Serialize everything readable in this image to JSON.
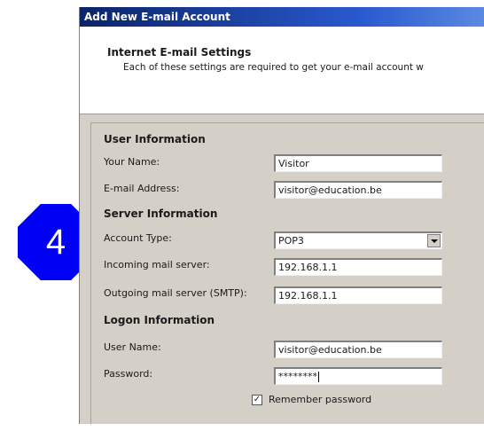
{
  "window": {
    "title": "Add New E-mail Account"
  },
  "header": {
    "title": "Internet E-mail Settings",
    "subtitle": "Each of these settings are required to get your e-mail account w"
  },
  "user_info": {
    "section_title": "User Information",
    "name_label": "Your Name:",
    "name_value": "Visitor",
    "email_label": "E-mail Address:",
    "email_value": "visitor@education.be"
  },
  "server_info": {
    "section_title": "Server Information",
    "account_type_label": "Account Type:",
    "account_type_value": "POP3",
    "incoming_label": "Incoming mail server:",
    "incoming_value": "192.168.1.1",
    "outgoing_label": "Outgoing mail server (SMTP):",
    "outgoing_value": "192.168.1.1"
  },
  "logon_info": {
    "section_title": "Logon Information",
    "username_label": "User Name:",
    "username_value": "visitor@education.be",
    "password_label": "Password:",
    "password_value": "********",
    "remember_label": "Remember password",
    "remember_checked": true,
    "remember_mark": "✓"
  },
  "badge": {
    "text": "4",
    "color": "#0000f5"
  }
}
